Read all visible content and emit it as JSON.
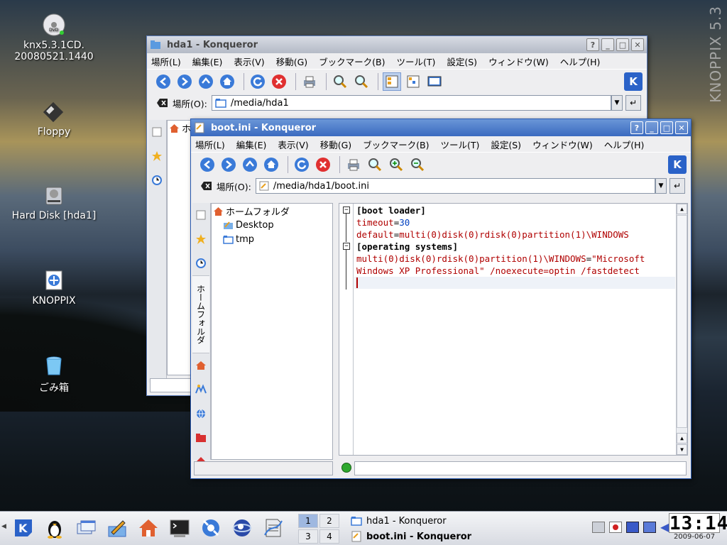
{
  "desktop": {
    "brand": "KNOPPIX 5.3",
    "icons": [
      {
        "label_line1": "knx5.3.1CD.",
        "label_line2": "20080521.1440",
        "icon": "dvd-icon"
      },
      {
        "label": "Floppy",
        "icon": "floppy-icon"
      },
      {
        "label": "Hard Disk [hda1]",
        "icon": "harddisk-icon"
      },
      {
        "label": "KNOPPIX",
        "icon": "knoppix-icon"
      },
      {
        "label": "ごみ箱",
        "icon": "trash-icon"
      }
    ]
  },
  "back_window": {
    "title": "hda1 - Konqueror",
    "menu": [
      "場所(L)",
      "編集(E)",
      "表示(V)",
      "移動(G)",
      "ブックマーク(B)",
      "ツール(T)",
      "設定(S)",
      "ウィンドウ(W)",
      "ヘルプ(H)"
    ],
    "location_label": "場所(O):",
    "location_value": "/media/hda1",
    "tree_partial": "ホ"
  },
  "front_window": {
    "title": "boot.ini - Konqueror",
    "menu": [
      "場所(L)",
      "編集(E)",
      "表示(V)",
      "移動(G)",
      "ブックマーク(B)",
      "ツール(T)",
      "設定(S)",
      "ウィンドウ(W)",
      "ヘルプ(H)"
    ],
    "location_label": "場所(O):",
    "location_value": "/media/hda1/boot.ini",
    "sidebar_tab_label": "ホームフォルダ",
    "tree": [
      {
        "label": "ホームフォルダ",
        "icon": "home-icon"
      },
      {
        "label": "Desktop",
        "icon": "desktop-folder-icon"
      },
      {
        "label": "tmp",
        "icon": "folder-icon"
      }
    ],
    "editor_lines": {
      "l1": "[boot loader]",
      "l2_key": "timeout",
      "l2_eq": "=",
      "l2_val": "30",
      "l3_key": "default",
      "l3_eq": "=",
      "l3_val": "multi(0)disk(0)rdisk(0)partition(1)\\WINDOWS",
      "l4": "[operating systems]",
      "l5_key": "multi(0)disk(0)rdisk(0)partition(1)\\WINDOWS",
      "l5_eq": "=",
      "l5_val": "\"Microsoft",
      "l6_val": "Windows XP Professional\" /noexecute=optin /fastdetect"
    }
  },
  "taskbar": {
    "pager": [
      "1",
      "2",
      "3",
      "4"
    ],
    "active_desktop": "1",
    "tasks": [
      {
        "label": "hda1 - Konqueror",
        "active": false
      },
      {
        "label": "boot.ini - Konqueror",
        "active": true
      }
    ],
    "clock_time": "13:14",
    "clock_date": "2009-06-07"
  },
  "colors": {
    "titlebar_active": "#3a6ac0",
    "key_red": "#b00000",
    "value_blue": "#0040c0"
  }
}
